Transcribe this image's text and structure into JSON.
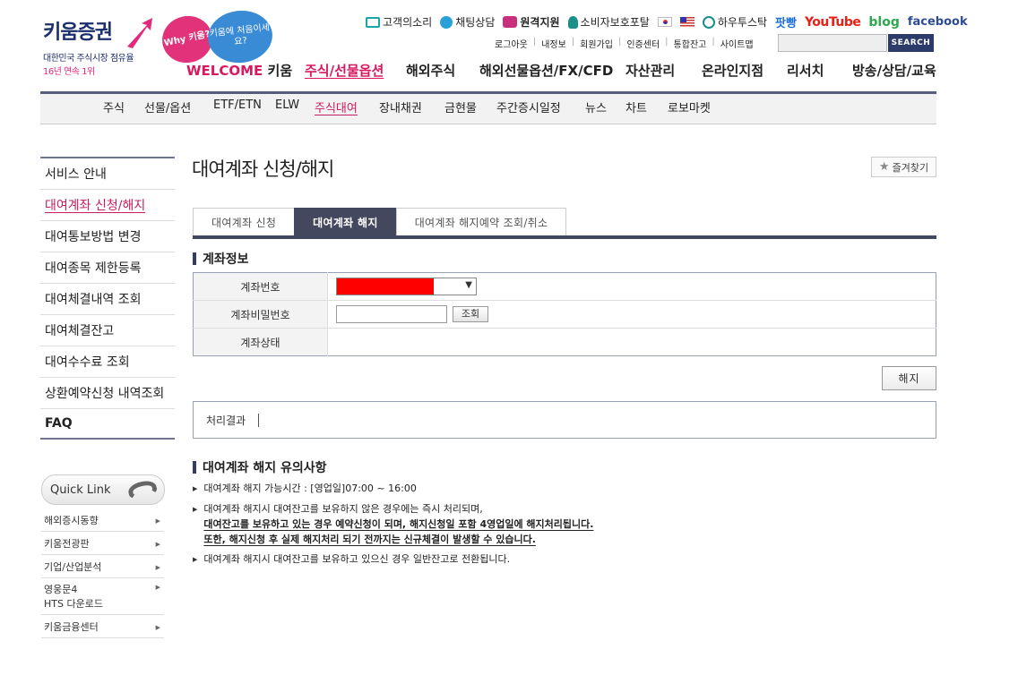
{
  "header": {
    "logo_text": "키움증권",
    "logo_sub1": "대한민국 주식시장 점유율",
    "logo_sub2": "16년 연속 1위",
    "bubble_why": "Why 키움?",
    "bubble_first": "키움에 처음이세요?",
    "top_links": [
      "고객의소리",
      "채팅상담",
      "원격지원",
      "소비자보호포탈",
      "하우투스탁"
    ],
    "paddang": "팟빵",
    "youtube": "YouTube",
    "blog": "blog",
    "facebook": "facebook",
    "util_links": [
      "로그아웃",
      "내정보",
      "회원가입",
      "인증센터",
      "통합잔고",
      "사이트맵"
    ],
    "search_label": "SEARCH",
    "gnb": {
      "welcome_1": "WELCOME",
      "welcome_2": "키움",
      "items": [
        "주식/선물옵션",
        "해외주식",
        "해외선물옵션/FX/CFD",
        "자산관리",
        "온라인지점",
        "리서치",
        "방송/상담/교육"
      ]
    },
    "sub_nav": [
      "주식",
      "선물/옵션",
      "ETF/ETN",
      "ELW",
      "주식대여",
      "장내채권",
      "금현물",
      "주간증시일정",
      "뉴스",
      "차트",
      "로보마켓"
    ]
  },
  "sidebar": {
    "items": [
      "서비스 안내",
      "대여계좌 신청/해지",
      "대여통보방법 변경",
      "대여종목 제한등록",
      "대여체결내역 조회",
      "대여체결잔고",
      "대여수수료 조회",
      "상환예약신청 내역조회",
      "FAQ"
    ],
    "quick_link": "Quick Link",
    "quick_items": [
      "해외증시동향",
      "키움전광판",
      "기업/산업분석",
      "영웅문4",
      "HTS 다운로드",
      "키움금융센터"
    ]
  },
  "main": {
    "title": "대여계좌 신청/해지",
    "fav_label": "즐겨찾기",
    "tabs": [
      "대여계좌 신청",
      "대여계좌 해지",
      "대여계좌 해지예약 조회/취소"
    ],
    "section_account": "계좌정보",
    "rows": {
      "account_no": "계좌번호",
      "account_pw": "계좌비밀번호",
      "account_status": "계좌상태"
    },
    "query_btn": "조회",
    "cancel_btn": "해지",
    "result_label": "처리결과",
    "section_notes": "대여계좌 해지 유의사항",
    "notes": {
      "n1": "대여계좌 해지 가능시간 : [영업일]07:00 ~ 16:00",
      "n2": "대여계좌 해지시 대여잔고를 보유하지 않은 경우에는 즉시 처리되며,",
      "n2_em1": "대여잔고를 보유하고 있는 경우 예약신청이 되며, 해지신청일 포함 4영업일에 해지처리됩니다.",
      "n2_em2": "또한, 해지신청 후 실제 해지처리 되기 전까지는 신규체결이 발생할 수 있습니다.",
      "n3": "대여계좌 해지시 대여잔고를 보유하고 있으신 경우 일반잔고로 전환됩니다."
    }
  },
  "colors": {
    "brand_navy": "#1b2e6e",
    "brand_pink": "#d8185f",
    "tab_active": "#44485f"
  }
}
